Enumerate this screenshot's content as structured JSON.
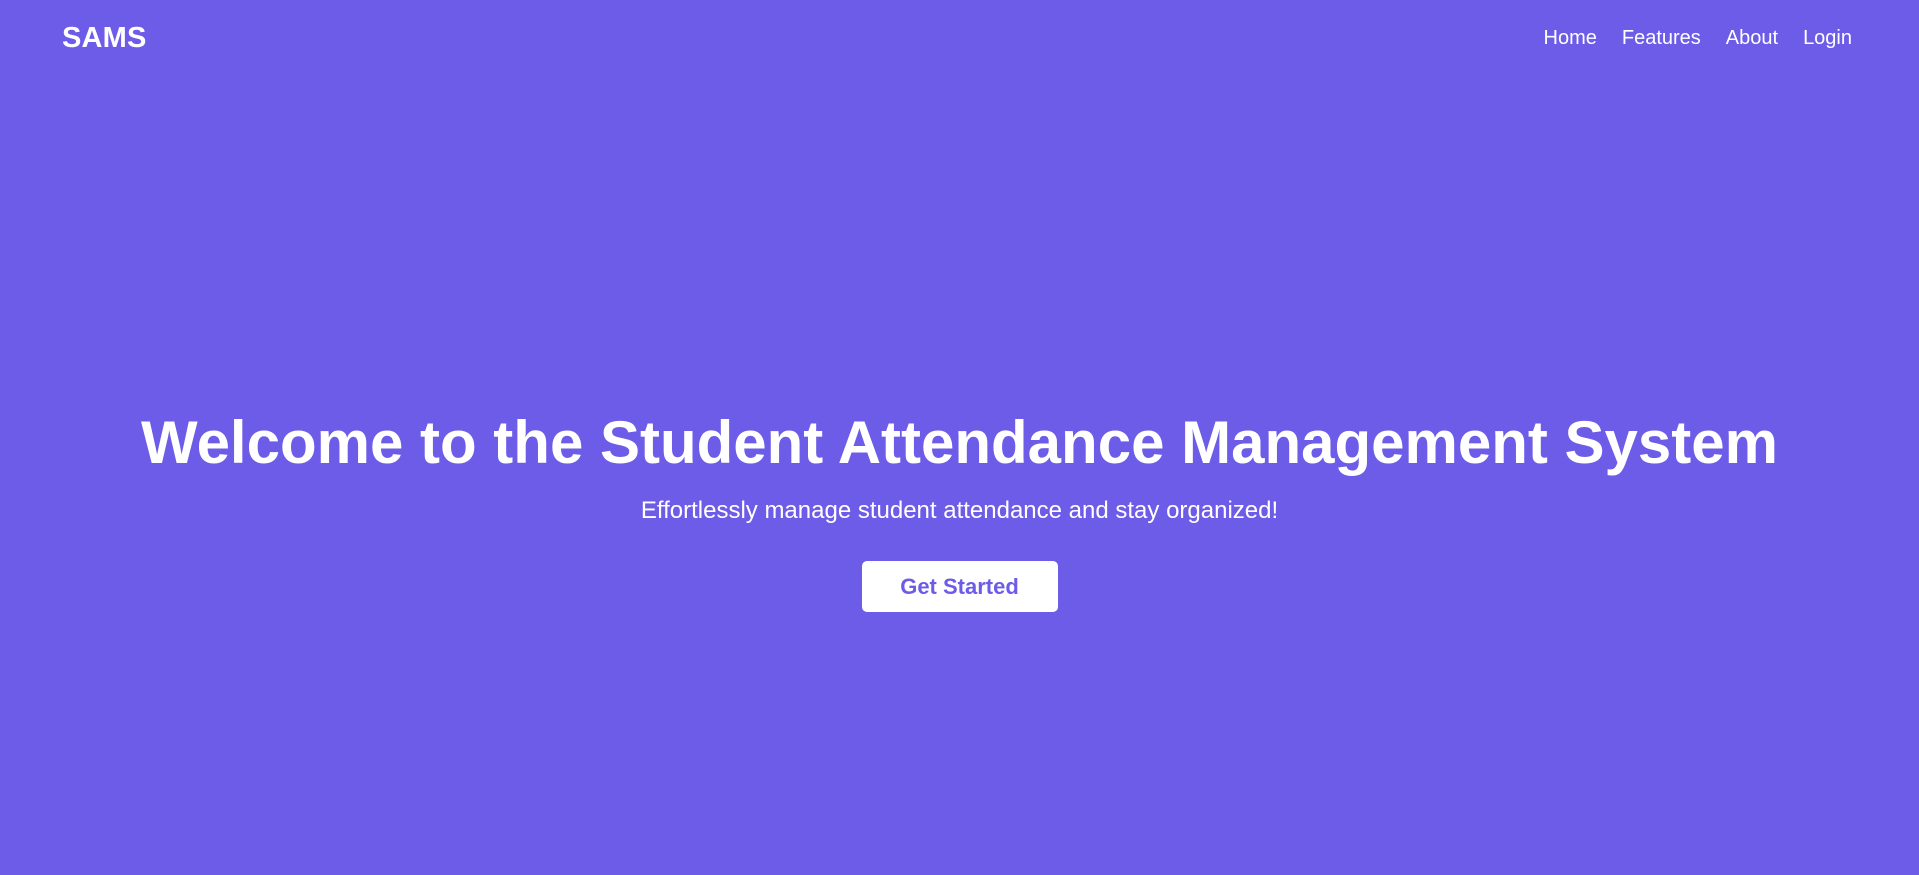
{
  "colors": {
    "background": "#6c5ce7",
    "text": "#ffffff",
    "button_background": "#ffffff",
    "button_text": "#6c5ce7"
  },
  "navbar": {
    "brand": "SAMS",
    "links": [
      {
        "label": "Home"
      },
      {
        "label": "Features"
      },
      {
        "label": "About"
      },
      {
        "label": "Login"
      }
    ]
  },
  "hero": {
    "title": "Welcome to the Student Attendance Management System",
    "subtitle": "Effortlessly manage student attendance and stay organized!",
    "cta_label": "Get Started"
  }
}
